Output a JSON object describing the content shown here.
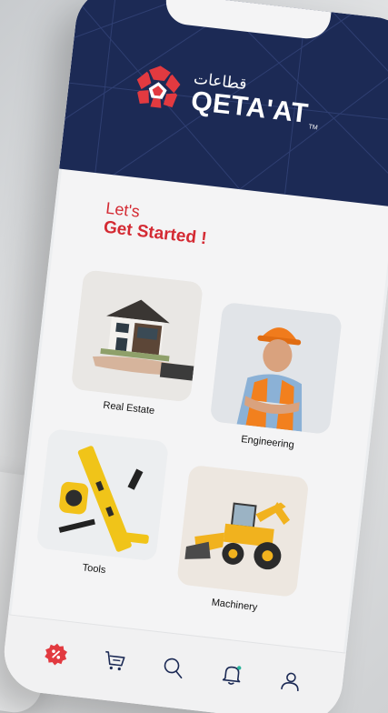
{
  "brand": {
    "name_latin": "QETA'AT",
    "name_arabic": "قطاعات",
    "trademark": "TM",
    "colors": {
      "navy": "#1c2a55",
      "red": "#e23a40"
    }
  },
  "greeting": {
    "line1": "Let's",
    "line2": "Get Started !"
  },
  "categories": [
    {
      "label": "Real Estate",
      "icon": "house-on-hand-image"
    },
    {
      "label": "Engineering",
      "icon": "engineer-image"
    },
    {
      "label": "Tools",
      "icon": "tools-image"
    },
    {
      "label": "Machinery",
      "icon": "backhoe-loader-image"
    }
  ],
  "nav": {
    "items": [
      {
        "name": "offers",
        "icon": "percent-badge-icon",
        "active": true
      },
      {
        "name": "cart",
        "icon": "cart-icon",
        "active": false
      },
      {
        "name": "search",
        "icon": "search-icon",
        "active": false
      },
      {
        "name": "notifications",
        "icon": "bell-icon",
        "active": false
      },
      {
        "name": "profile",
        "icon": "user-icon",
        "active": false
      }
    ]
  }
}
